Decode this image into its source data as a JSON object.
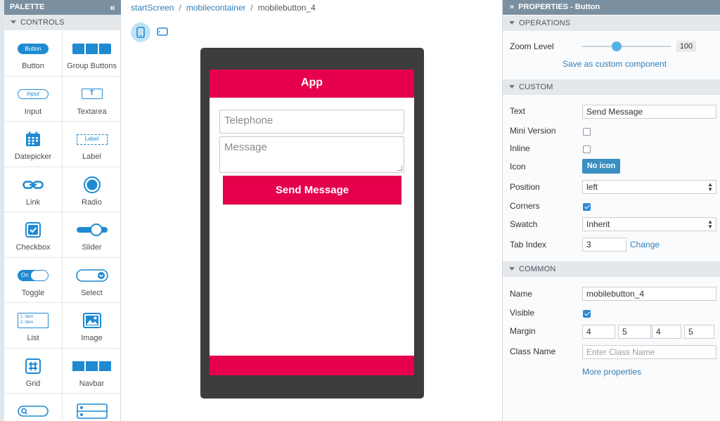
{
  "palette": {
    "title": "PALETTE",
    "section": "CONTROLS",
    "items": [
      {
        "label": "Button",
        "icon": "button-icon",
        "icon_text": "Button"
      },
      {
        "label": "Group Buttons",
        "icon": "group-buttons-icon"
      },
      {
        "label": "Input",
        "icon": "input-icon",
        "icon_text": "Input"
      },
      {
        "label": "Textarea",
        "icon": "textarea-icon",
        "icon_text": "T"
      },
      {
        "label": "Datepicker",
        "icon": "calendar-icon"
      },
      {
        "label": "Label",
        "icon": "label-icon",
        "icon_text": "Label"
      },
      {
        "label": "Link",
        "icon": "link-icon"
      },
      {
        "label": "Radio",
        "icon": "radio-icon"
      },
      {
        "label": "Checkbox",
        "icon": "checkbox-icon"
      },
      {
        "label": "Slider",
        "icon": "slider-icon"
      },
      {
        "label": "Toggle",
        "icon": "toggle-icon",
        "icon_text": "On"
      },
      {
        "label": "Select",
        "icon": "select-icon"
      },
      {
        "label": "List",
        "icon": "list-icon",
        "icon_text_1": "1. Item",
        "icon_text_2": "2. Item"
      },
      {
        "label": "Image",
        "icon": "image-icon"
      },
      {
        "label": "Grid",
        "icon": "grid-icon"
      },
      {
        "label": "Navbar",
        "icon": "navbar-icon"
      },
      {
        "label": "",
        "icon": "search-icon"
      },
      {
        "label": "",
        "icon": "form-list-icon"
      }
    ]
  },
  "breadcrumb": [
    "startScreen",
    "mobilecontainer",
    "mobilebutton_4"
  ],
  "breadcrumb_sep": "/",
  "device": {
    "app_title": "App",
    "telephone_placeholder": "Telephone",
    "message_placeholder": "Message",
    "button_label": "Send Message",
    "accent_color": "#e6004c"
  },
  "properties": {
    "title": "PROPERTIES - Button",
    "operations": {
      "section": "OPERATIONS",
      "zoom_label": "Zoom Level",
      "zoom_value": "100",
      "save_link": "Save as custom component"
    },
    "custom": {
      "section": "CUSTOM",
      "text_label": "Text",
      "text_value": "Send Message",
      "mini_label": "Mini Version",
      "mini_checked": false,
      "inline_label": "Inline",
      "inline_checked": false,
      "icon_label": "Icon",
      "icon_button": "No icon",
      "position_label": "Position",
      "position_value": "left",
      "corners_label": "Corners",
      "corners_checked": true,
      "swatch_label": "Swatch",
      "swatch_value": "Inherit",
      "tabindex_label": "Tab Index",
      "tabindex_value": "3",
      "tabindex_link": "Change"
    },
    "common": {
      "section": "COMMON",
      "name_label": "Name",
      "name_value": "mobilebutton_4",
      "visible_label": "Visible",
      "visible_checked": true,
      "margin_label": "Margin",
      "margin_values": [
        "4",
        "5",
        "4",
        "5"
      ],
      "classname_label": "Class Name",
      "classname_placeholder": "Enter Class Name",
      "more_link": "More properties"
    }
  }
}
